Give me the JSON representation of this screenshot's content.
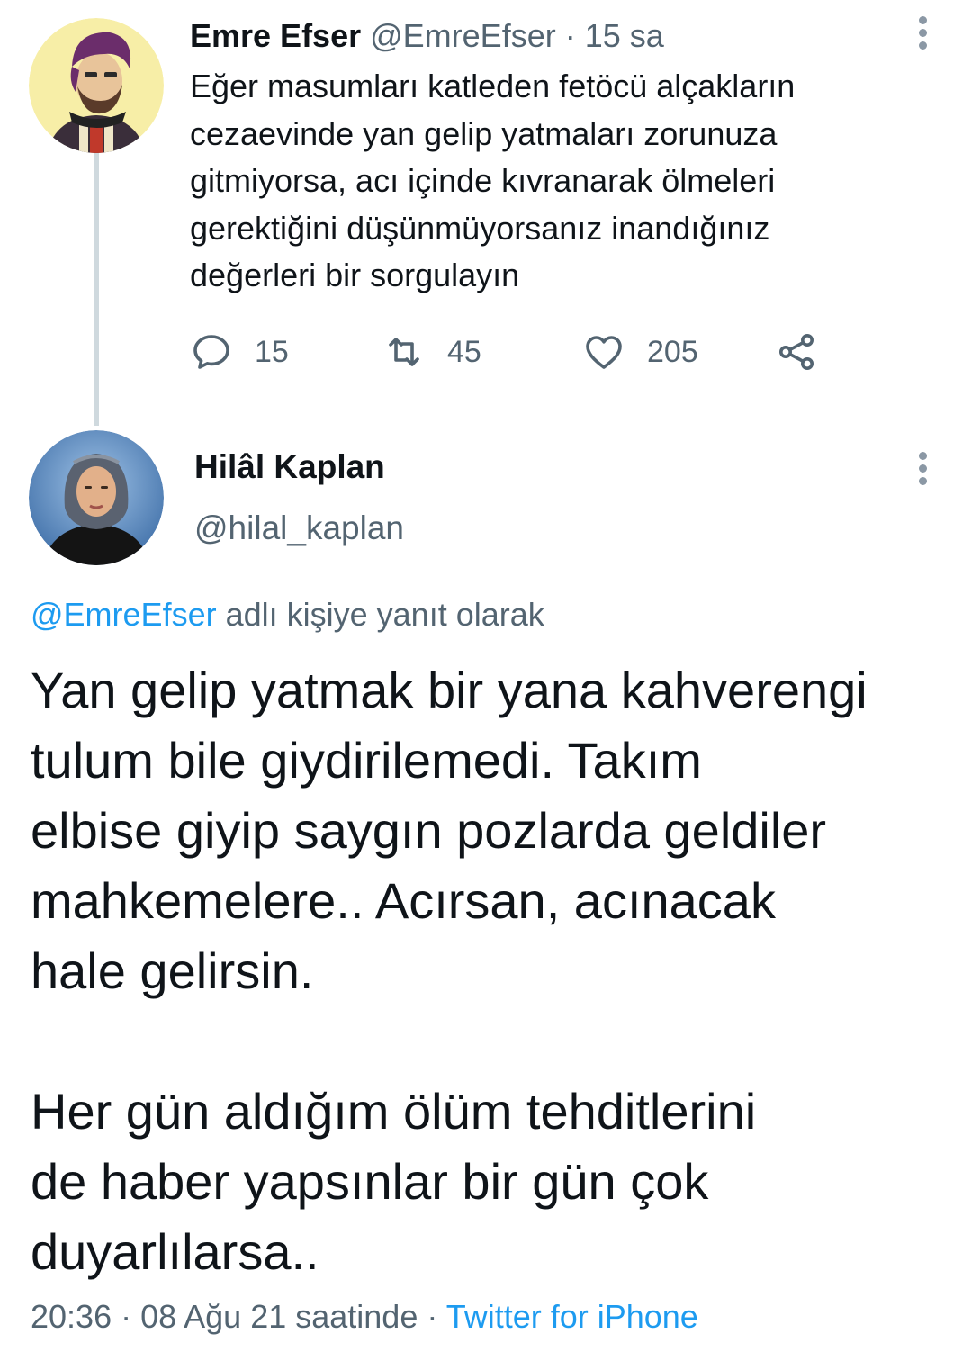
{
  "tweets": [
    {
      "author_name": "Emre Efser",
      "handle": "@EmreEfser",
      "separator": "·",
      "time": "15 sa",
      "lines": [
        "Eğer masumları katleden fetöcü alçakların",
        "cezaevinde yan gelip yatmaları zorunuza",
        "gitmiyorsa, acı içinde kıvranarak ölmeleri",
        "gerektiğini düşünmüyorsanız inandığınız",
        "değerleri bir sorgulayın"
      ],
      "replies": "15",
      "retweets": "45",
      "likes": "205"
    }
  ],
  "main_tweet": {
    "author_name": "Hilâl Kaplan",
    "handle": "@hilal_kaplan",
    "reply_to_mention": "@EmreEfser",
    "reply_to_suffix": " adlı kişiye yanıt olarak",
    "paragraphs": [
      [
        "Yan gelip yatmak bir yana kahverengi",
        "tulum bile giydirilemedi. Takım",
        "elbise giyip saygın pozlarda geldiler",
        "mahkemelere.. Acırsan, acınacak",
        "hale gelirsin."
      ],
      [
        "Her gün aldığım ölüm tehditlerini",
        "de haber yapsınlar bir gün çok",
        "duyarlılarsa.."
      ]
    ],
    "timestamp": "20:36 · 08 Ağu 21 saatinde ·",
    "source": "Twitter for iPhone"
  },
  "icons": {
    "reply": "reply-icon",
    "retweet": "retweet-icon",
    "like": "heart-icon",
    "share": "share-icon",
    "more": "more-vertical-icon"
  },
  "colors": {
    "link": "#1d9bf0",
    "secondary_text": "#536471",
    "thread_line": "#cfd9de"
  }
}
